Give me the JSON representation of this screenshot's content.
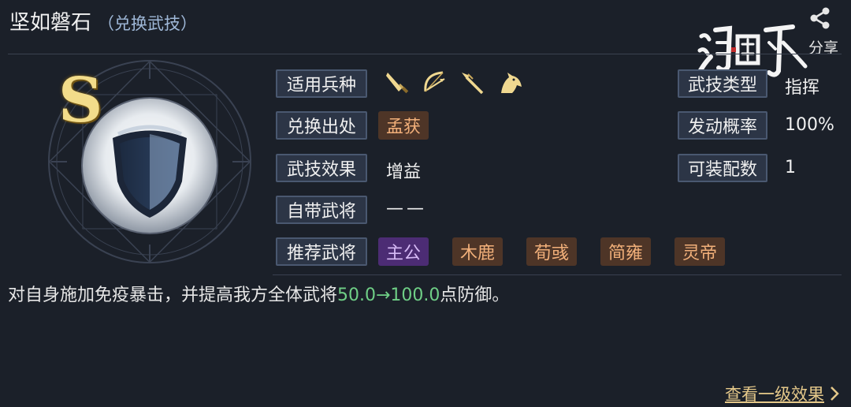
{
  "skill": {
    "name": "坚如磐石",
    "subtitle": "（兑换武技）",
    "grade": "S"
  },
  "share": {
    "label": "分享",
    "icon": "share-icon"
  },
  "logo": {
    "text": "鸿图之下",
    "icon": "game-logo"
  },
  "attributes": {
    "troops_label": "适用兵种",
    "troops": [
      "sword-icon",
      "bow-icon",
      "spear-icon",
      "horse-icon"
    ],
    "source_label": "兑换出处",
    "source_value": "孟获",
    "effect_label": "武技效果",
    "effect_value": "增益",
    "general_label": "自带武将",
    "general_value": "——",
    "recommend_label": "推荐武将",
    "recommend_values": [
      "主公",
      "木鹿",
      "荀彧",
      "简雍",
      "灵帝"
    ],
    "type_label": "武技类型",
    "type_value": "指挥",
    "rate_label": "发动概率",
    "rate_value": "100%",
    "equip_label": "可装配数",
    "equip_value": "1"
  },
  "description": {
    "before": "对自身施加免疫暴击，并提高我方全体武将",
    "highlight": "50.0→100.0",
    "after": "点防御。"
  },
  "more_link": {
    "label": "查看一级效果",
    "arrow": "chevron-right-icon"
  },
  "colors": {
    "background": "#1b2029",
    "label_bg": "#2c3546",
    "tag_orange": "#4e3527",
    "tag_purple": "#4c2c74",
    "highlight_green": "#6fcf86",
    "link_gold": "#e6c98a"
  }
}
